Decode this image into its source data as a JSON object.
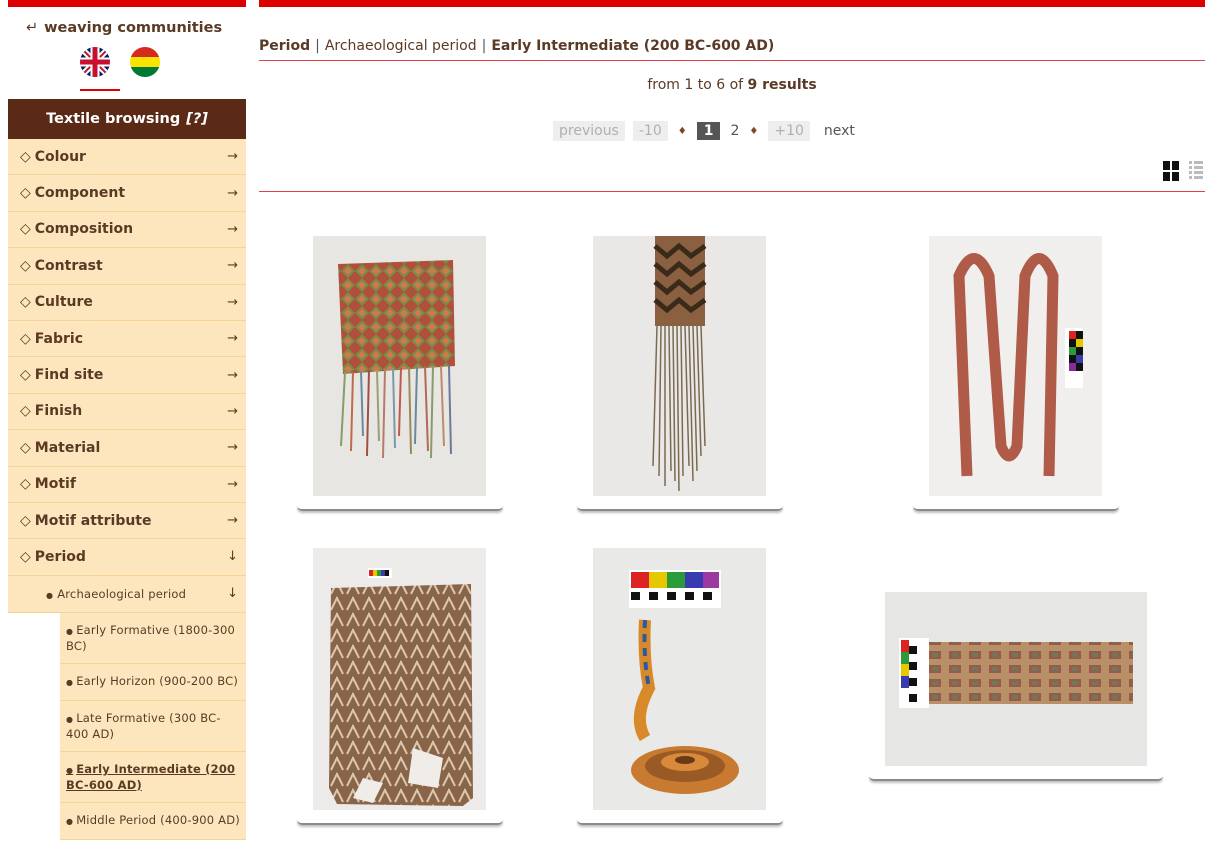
{
  "sidebar": {
    "back_link": "weaving communities",
    "back_arrow": "↵",
    "languages": [
      {
        "name": "English",
        "icon": "uk-flag-icon",
        "active": true
      },
      {
        "name": "Bolivia",
        "icon": "bolivia-flag-icon",
        "active": false
      }
    ],
    "header": "Textile browsing",
    "help": "[?]",
    "items": [
      {
        "label": "Colour",
        "arrow": "→"
      },
      {
        "label": "Component",
        "arrow": "→"
      },
      {
        "label": "Composition",
        "arrow": "→"
      },
      {
        "label": "Contrast",
        "arrow": "→"
      },
      {
        "label": "Culture",
        "arrow": "→"
      },
      {
        "label": "Fabric",
        "arrow": "→"
      },
      {
        "label": "Find site",
        "arrow": "→"
      },
      {
        "label": "Finish",
        "arrow": "→"
      },
      {
        "label": "Material",
        "arrow": "→"
      },
      {
        "label": "Motif",
        "arrow": "→"
      },
      {
        "label": "Motif attribute",
        "arrow": "→"
      },
      {
        "label": "Period",
        "arrow": "↓"
      }
    ],
    "diamond": "◇",
    "sub_item": {
      "label": "Archaeological period",
      "arrow": "↓",
      "bullet": "●"
    },
    "periods": [
      {
        "label": "Early Formative (1800-300 BC)",
        "active": false
      },
      {
        "label": "Early Horizon (900-200 BC)",
        "active": false
      },
      {
        "label": "Late Formative (300 BC-400 AD)",
        "active": false
      },
      {
        "label": "Early Intermediate (200 BC-600 AD)",
        "active": true
      },
      {
        "label": "Middle Period (400-900 AD)",
        "active": false
      }
    ]
  },
  "breadcrumb": {
    "part1": "Period",
    "sep": "|",
    "part2": "Archaeological period",
    "part3": "Early Intermediate (200 BC-600 AD)"
  },
  "results": {
    "prefix": "from 1 to 6 of",
    "count": "9 results"
  },
  "pagination": {
    "previous": "previous",
    "minus10": "-10",
    "dot": "♦",
    "current": "1",
    "page2": "2",
    "plus10": "+10",
    "next": "next"
  },
  "colors": {
    "accent_red": "#dd0000",
    "sidebar_header": "#5b2a17",
    "menu_bg": "#fde6bd",
    "text_brown": "#5b3a25"
  }
}
